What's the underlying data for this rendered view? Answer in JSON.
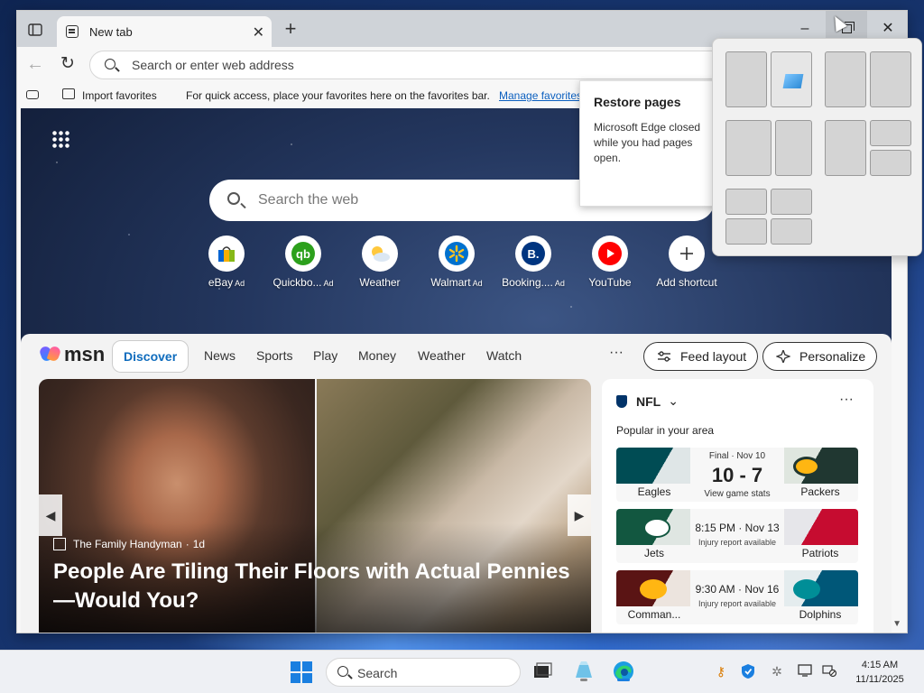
{
  "browser": {
    "tab_title": "New tab",
    "new_tab_symbol": "+",
    "close_symbol": "✕",
    "minimize_symbol": "–",
    "address_placeholder": "Search or enter web address",
    "favorites": {
      "import_label": "Import favorites",
      "hint": "For quick access, place your favorites here on the favorites bar.",
      "manage_link": "Manage favorites"
    }
  },
  "newtab": {
    "search_placeholder": "Search the web",
    "shortcuts": [
      {
        "label": "eBay",
        "ad": "Ad",
        "icon": "ebay-icon"
      },
      {
        "label": "Quickbo...",
        "ad": "Ad",
        "icon": "quickbooks-icon"
      },
      {
        "label": "Weather",
        "ad": "",
        "icon": "weather-icon"
      },
      {
        "label": "Walmart",
        "ad": "Ad",
        "icon": "walmart-icon"
      },
      {
        "label": "Booking....",
        "ad": "Ad",
        "icon": "booking-icon"
      },
      {
        "label": "YouTube",
        "ad": "",
        "icon": "youtube-icon"
      },
      {
        "label": "Add shortcut",
        "ad": "",
        "icon": "plus-icon"
      }
    ]
  },
  "msn": {
    "logo_text": "msn",
    "nav": [
      "Discover",
      "News",
      "Sports",
      "Play",
      "Money",
      "Weather",
      "Watch"
    ],
    "more": "···",
    "feed_layout": "Feed layout",
    "personalize": "Personalize",
    "hero": {
      "source": "The Family Handyman",
      "age": "1d",
      "title": "People Are Tiling Their Floors with Actual Pennies—Would You?"
    },
    "nfl": {
      "title": "NFL",
      "subtitle": "Popular in your area",
      "games": [
        {
          "team1": "Eagles",
          "team2": "Packers",
          "status": "Final · Nov 10",
          "score": "10 - 7",
          "note": "View game stats"
        },
        {
          "team1": "Jets",
          "team2": "Patriots",
          "status": "8:15 PM · Nov 13",
          "score": "",
          "note": "Injury report available"
        },
        {
          "team1": "Comman...",
          "team2": "Dolphins",
          "status": "9:30 AM · Nov 16",
          "score": "",
          "note": "Injury report available"
        }
      ]
    }
  },
  "restore": {
    "title": "Restore pages",
    "message": "Microsoft Edge closed while you had pages open."
  },
  "taskbar": {
    "search_label": "Search",
    "time": "4:15 AM",
    "date": "11/11/2025"
  },
  "colors": {
    "accent": "#0f6cbd",
    "windows_blue": "#1a7fe0"
  }
}
